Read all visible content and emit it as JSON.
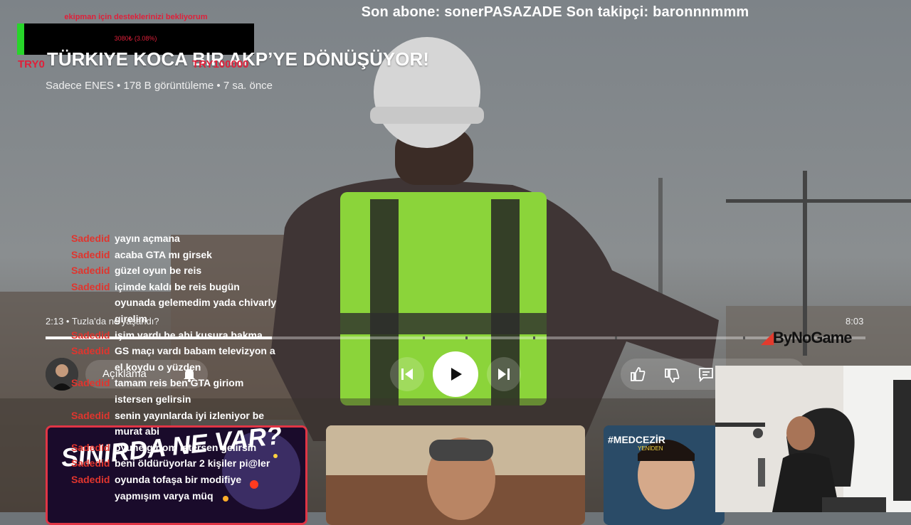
{
  "donation_goal": {
    "caption": "ekipman için desteklerinizi bekliyorum",
    "progress_text": "3080₺ (3.08%)",
    "progress_fraction": 0.0308,
    "min_label": "TRY0",
    "max_label": "TRY100000"
  },
  "ticker": {
    "text": "Son abone: sonerPASAZADE  Son takipçi: baronnnmmm"
  },
  "video": {
    "title": "TÜRKIYE KOCA BIR AKP’YE DÖNÜŞÜYOR!",
    "meta": "Sadece ENES • 178 B görüntüleme • 7 sa. önce",
    "time_current_chapter": "2:13 • Tuzla'da ne yaşandı?",
    "duration": "8:03",
    "progress_fraction": 0.276
  },
  "chat": [
    {
      "user": "Sadedid",
      "message": "yayın açmana"
    },
    {
      "user": "Sadedid",
      "message": "acaba GTA mı girsek"
    },
    {
      "user": "Sadedid",
      "message": "güzel oyun be reis"
    },
    {
      "user": "Sadedid",
      "message": "içimde kaldı be reis bugün oyunada gelemedim yada chivarly girelim"
    },
    {
      "user": "Sadedid",
      "message": "işim vardı be abi kusura bakma"
    },
    {
      "user": "Sadedid",
      "message": "GS maçı vardı babam televizyon a el koydu o yüzden"
    },
    {
      "user": "Sadedid",
      "message": "tamam reis ben GTA giriom istersen gelirsin"
    },
    {
      "user": "Sadedid",
      "message": "senin yayınlarda iyi izleniyor be murat abi"
    },
    {
      "user": "Sadedid",
      "message": "oyune giriom istersen gelirsin"
    },
    {
      "user": "Sadedid",
      "message": "beni öldürüyorlar 2 kişiler pi@ler"
    },
    {
      "user": "Sadedid",
      "message": "oyunda tofaşa bir modifiye yapmışım varya müq"
    }
  ],
  "controls": {
    "description_label": "Açıklama"
  },
  "brand": {
    "name": "ByNoGame"
  },
  "thumbnails": [
    {
      "text": "SINIRDA NE VAR?"
    },
    {
      "text": ""
    },
    {
      "tag": "#MEDCEZİR",
      "tag2": "YENİDEN"
    }
  ],
  "colors": {
    "chat_user": "#e0352e",
    "goal_fill": "#27d52a",
    "goal_text": "#e0203a"
  },
  "icons": [
    "play-icon",
    "previous-icon",
    "next-icon",
    "bell-icon",
    "thumbs-up-icon",
    "thumbs-down-icon",
    "comment-icon"
  ]
}
